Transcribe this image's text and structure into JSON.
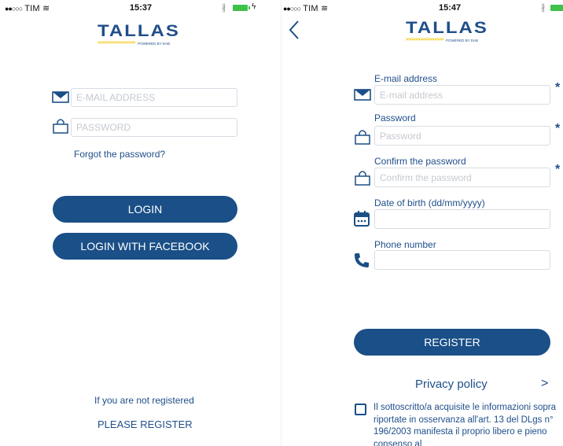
{
  "login_screen": {
    "status_bar": {
      "carrier": "TIM",
      "time": "15:37"
    },
    "logo": {
      "word": "TALLAS",
      "tagline": "POWERED BY DAB",
      "chevrons": ">>>>>>>>>>>>>>>>"
    },
    "email_placeholder": "E-MAIL ADDRESS",
    "password_placeholder": "PASSWORD",
    "forgot_link": "Forgot the password?",
    "login_button": "LOGIN",
    "facebook_button": "LOGIN WITH FACEBOOK",
    "not_registered_text": "If you are not registered",
    "register_link": "PLEASE REGISTER"
  },
  "register_screen": {
    "status_bar": {
      "carrier": "TIM",
      "time": "15:47"
    },
    "logo": {
      "word": "TALLAS",
      "tagline": "POWERED BY DAB",
      "chevrons": ">>>>>>>>>>>>>>>>"
    },
    "back_icon": "chevron-left-icon",
    "required_mark": "*",
    "fields": [
      {
        "label": "E-mail address",
        "placeholder": "E-mail address",
        "icon": "envelope-icon"
      },
      {
        "label": "Password",
        "placeholder": "Password",
        "icon": "lock-icon"
      },
      {
        "label": "Confirm the password",
        "placeholder": "Confirm the password",
        "icon": "lock-icon"
      },
      {
        "label": "Date of birth (dd/mm/yyyy)",
        "placeholder": "",
        "icon": "calendar-icon"
      },
      {
        "label": "Phone number",
        "placeholder": "",
        "icon": "phone-icon"
      }
    ],
    "register_button": "REGISTER",
    "privacy_label": "Privacy policy",
    "privacy_chevron": ">",
    "consent_text": "Il sottoscritto/a acquisite le informazioni sopra riportate in osservanza all'art. 13 del DLgs n° 196/2003 manifesta il proprio libero e pieno consenso al"
  },
  "colors": {
    "primary": "#1a4f87",
    "accent_yellow": "#f2c400",
    "input_border": "#d7dde4",
    "battery": "#3fc24a"
  }
}
